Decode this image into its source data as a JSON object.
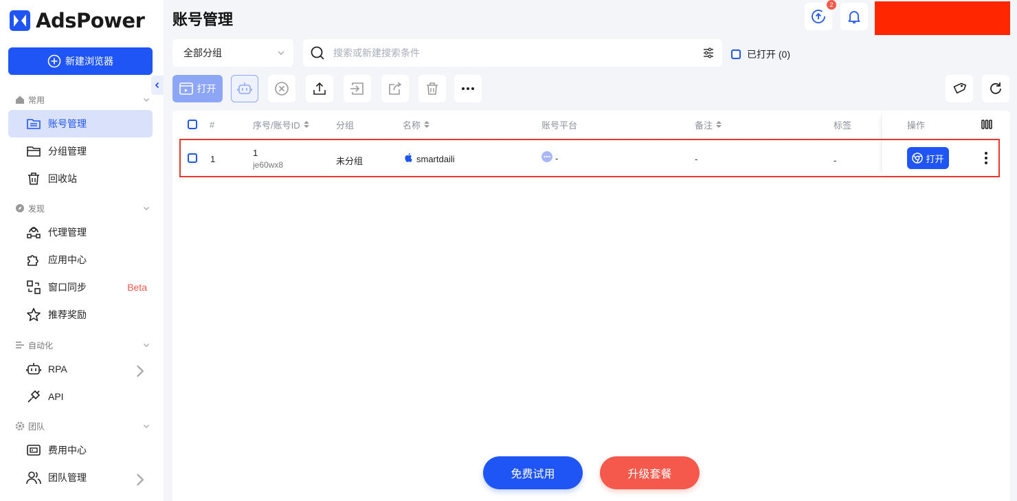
{
  "app": {
    "brand": "AdsPower",
    "accent": "#1f55f5",
    "danger": "#f5594c"
  },
  "sidebar": {
    "new_browser": "新建浏览器",
    "sections": [
      {
        "label": "常用"
      },
      {
        "label": "发现"
      },
      {
        "label": "自动化"
      },
      {
        "label": "团队"
      }
    ],
    "items": [
      {
        "label": "账号管理",
        "active": true
      },
      {
        "label": "分组管理"
      },
      {
        "label": "回收站"
      },
      {
        "label": "代理管理"
      },
      {
        "label": "应用中心"
      },
      {
        "label": "窗口同步",
        "badge": "Beta"
      },
      {
        "label": "推荐奖励"
      },
      {
        "label": "RPA"
      },
      {
        "label": "API"
      },
      {
        "label": "费用中心"
      },
      {
        "label": "团队管理"
      }
    ]
  },
  "header": {
    "title": "账号管理",
    "upload_badge": "2"
  },
  "filters": {
    "group": "全部分组",
    "search_placeholder": "搜索或新建搜索条件",
    "opened_label": "已打开 (0)"
  },
  "toolbar": {
    "open_label": "打开"
  },
  "table": {
    "columns": [
      "#",
      "序号/账号ID",
      "分组",
      "名称",
      "账号平台",
      "备注",
      "标签",
      "操作"
    ],
    "rows": [
      {
        "index": "1",
        "serial": "1",
        "account_id": "je60wx8",
        "group": "未分组",
        "name": "smartdaili",
        "platform": "-",
        "remark": "-",
        "tags": "-",
        "action": "打开"
      }
    ]
  },
  "footer": {
    "trial": "免费试用",
    "upgrade": "升级套餐"
  }
}
